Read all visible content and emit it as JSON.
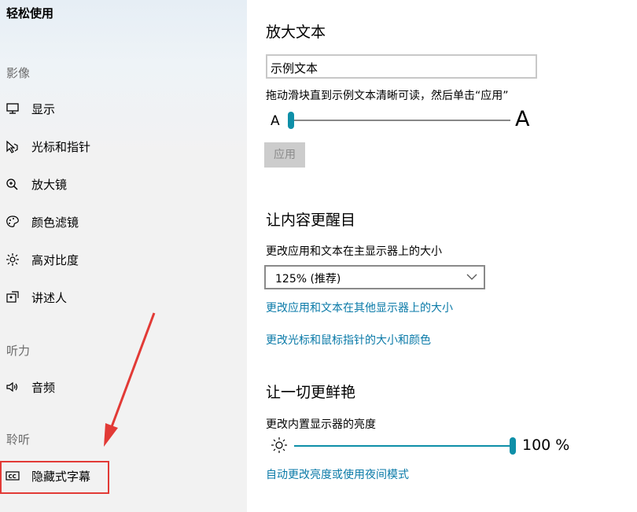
{
  "sidebar": {
    "title": "轻松使用",
    "sections": {
      "vision": "影像",
      "hearing": "听力",
      "listening": "聆听"
    },
    "items": [
      {
        "label": "显示",
        "icon": "monitor-icon"
      },
      {
        "label": "光标和指针",
        "icon": "cursor-icon"
      },
      {
        "label": "放大镜",
        "icon": "magnifier-icon"
      },
      {
        "label": "颜色滤镜",
        "icon": "palette-icon"
      },
      {
        "label": "高对比度",
        "icon": "contrast-icon"
      },
      {
        "label": "讲述人",
        "icon": "narrator-icon"
      },
      {
        "label": "音频",
        "icon": "speaker-icon"
      },
      {
        "label": "隐藏式字幕",
        "icon": "cc-icon"
      }
    ]
  },
  "text_size": {
    "heading": "放大文本",
    "sample_text": "示例文本",
    "instruction": "拖动滑块直到示例文本清晰可读，然后单击“应用”",
    "small_a": "A",
    "large_a": "A",
    "slider_value_fraction": 0.0,
    "apply_label": "应用"
  },
  "bigger": {
    "heading": "让内容更醒目",
    "scale_label": "更改应用和文本在主显示器上的大小",
    "scale_value": "125% (推荐)",
    "link_other_displays": "更改应用和文本在其他显示器上的大小",
    "link_cursor": "更改光标和鼠标指针的大小和颜色"
  },
  "brighter": {
    "heading": "让一切更鲜艳",
    "brightness_label": "更改内置显示器的亮度",
    "brightness_value": "100 %",
    "brightness_fraction": 1.0,
    "link_night": "自动更改亮度或使用夜间模式"
  },
  "colors": {
    "accent": "#0e8fa8",
    "link": "#0a7aa8",
    "highlight": "#e23a36"
  }
}
